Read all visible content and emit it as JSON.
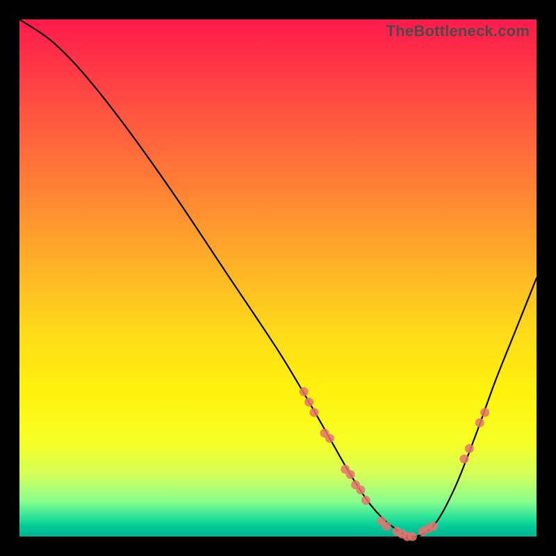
{
  "watermark": "TheBottleneck.com",
  "colors": {
    "marker": "#e6736e",
    "curve": "#000000"
  },
  "chart_data": {
    "type": "line",
    "title": "",
    "xlabel": "",
    "ylabel": "",
    "xlim": [
      0,
      100
    ],
    "ylim": [
      0,
      100
    ],
    "grid": false,
    "curve": {
      "x": [
        0,
        6,
        12,
        20,
        30,
        40,
        50,
        56,
        60,
        64,
        68,
        72,
        76,
        80,
        84,
        88,
        92,
        96,
        100
      ],
      "y": [
        100,
        96,
        90,
        80,
        66,
        51,
        36,
        26,
        19,
        12,
        6,
        2,
        0,
        2,
        9,
        19,
        30,
        40,
        50
      ]
    },
    "markers": [
      {
        "x": 55,
        "y": 28
      },
      {
        "x": 56,
        "y": 26
      },
      {
        "x": 57,
        "y": 24
      },
      {
        "x": 59,
        "y": 20
      },
      {
        "x": 60,
        "y": 19
      },
      {
        "x": 63,
        "y": 13
      },
      {
        "x": 64,
        "y": 12
      },
      {
        "x": 65,
        "y": 10
      },
      {
        "x": 66,
        "y": 9
      },
      {
        "x": 67,
        "y": 7
      },
      {
        "x": 70,
        "y": 3
      },
      {
        "x": 71,
        "y": 2
      },
      {
        "x": 73,
        "y": 1
      },
      {
        "x": 74,
        "y": 0.5
      },
      {
        "x": 75,
        "y": 0
      },
      {
        "x": 76,
        "y": 0
      },
      {
        "x": 78,
        "y": 1
      },
      {
        "x": 79,
        "y": 1.5
      },
      {
        "x": 80,
        "y": 2
      },
      {
        "x": 86,
        "y": 15
      },
      {
        "x": 87,
        "y": 17
      },
      {
        "x": 89,
        "y": 22
      },
      {
        "x": 90,
        "y": 24
      }
    ]
  }
}
